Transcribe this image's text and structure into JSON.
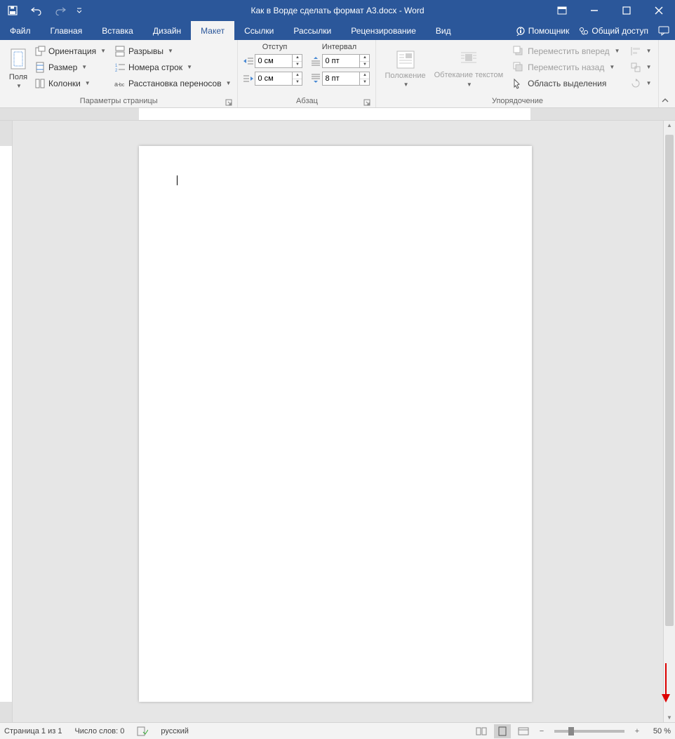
{
  "title": "Как в Ворде сделать формат А3.docx - Word",
  "tabs": {
    "file": "Файл",
    "home": "Главная",
    "insert": "Вставка",
    "design": "Дизайн",
    "layout": "Макет",
    "references": "Ссылки",
    "mailings": "Рассылки",
    "review": "Рецензирование",
    "view": "Вид",
    "tell_me": "Помощник"
  },
  "share": "Общий доступ",
  "ribbon": {
    "page_setup": {
      "margins": "Поля",
      "orientation": "Ориентация",
      "size": "Размер",
      "columns": "Колонки",
      "breaks": "Разрывы",
      "line_numbers": "Номера строк",
      "hyphenation": "Расстановка переносов",
      "label": "Параметры страницы"
    },
    "paragraph": {
      "indent_label": "Отступ",
      "spacing_label": "Интервал",
      "indent_left": "0 см",
      "indent_right": "0 см",
      "spacing_before": "0 пт",
      "spacing_after": "8 пт",
      "label": "Абзац"
    },
    "arrange": {
      "position": "Положение",
      "wrap": "Обтекание текстом",
      "bring_forward": "Переместить вперед",
      "send_backward": "Переместить назад",
      "selection_pane": "Область выделения",
      "label": "Упорядочение"
    }
  },
  "status": {
    "page": "Страница 1 из 1",
    "words": "Число слов: 0",
    "language": "русский",
    "zoom": "50 %"
  }
}
